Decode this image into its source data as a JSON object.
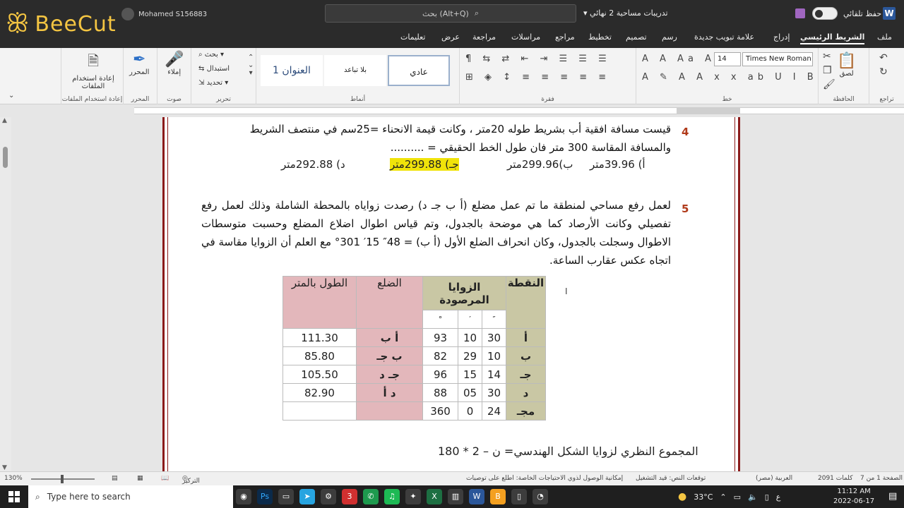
{
  "titlebar": {
    "brand": "BeeCut",
    "user": "Mohamed S156883",
    "search_placeholder": "بحث (Alt+Q)",
    "doc_title": "تدريبات مساحية 2 نهائي",
    "autosave": "حفظ تلقائي"
  },
  "tabs": [
    "ملف",
    "الشريط الرئيسي",
    "إدراج",
    "علامة تبويب جديدة",
    "رسم",
    "تصميم",
    "تخطيط",
    "مراجع",
    "مراسلات",
    "مراجعة",
    "عرض",
    "تعليمات"
  ],
  "ribbon": {
    "undo_label": "تراجع",
    "clipboard": {
      "paste": "لصق",
      "group": "الحافظة"
    },
    "font": {
      "name": "Times New Roman (",
      "size": "14",
      "group": "خط"
    },
    "paragraph": {
      "group": "فقرة"
    },
    "styles": {
      "items": [
        "عادي",
        "بلا تباعد",
        "العنوان 1"
      ],
      "group": "أنماط"
    },
    "editing": {
      "find": "بحث",
      "replace": "استبدال",
      "select": "تحديد",
      "group": "تحرير"
    },
    "voice": {
      "dictate": "إملاء",
      "group": "صوت"
    },
    "editor": {
      "label": "المحرر",
      "group": "المحرر"
    },
    "reuse": {
      "label": "إعادة استخدام الملفات",
      "group": "إعادة استخدام الملفات"
    }
  },
  "document": {
    "q4": {
      "num": "4",
      "text": "قيست مسافة افقية أب بشريط طوله 20متر ، وكانت قيمة الانحناء =25سم في منتصف الشريط والمسافة المقاسة 300 متر فان طول الخط الحقيقي = ..........",
      "options": [
        "أ) 39.96متر",
        "ب)299.96متر",
        "جـ) 299.88متر",
        "د) 292.88متر"
      ]
    },
    "q5": {
      "num": "5",
      "text": "لعمل رفع مساحي لمنطقة ما تم عمل مضلع (أ ب جـ د) رصدت زواياه بالمحطة الشاملة وذلك لعمل رفع تفصيلي وكانت الأرصاد كما هي موضحة بالجدول، وتم قياس اطوال اضلاع المضلع وحسبت متوسطات الاطوال وسجلت بالجدول، وكان انحراف الضلع الأول (أ ب) = 48″ 15′ 301° مع العلم أن الزوايا مقاسة في اتجاه عكس عقارب الساعة."
    },
    "table": {
      "headers": {
        "point": "النقطة",
        "angles": "الزوايا المرصودة",
        "side": "الضلع",
        "length": "الطول بالمتر"
      },
      "units": [
        "″",
        "′",
        "°"
      ],
      "rows": [
        {
          "point": "أ",
          "sec": "30",
          "min": "10",
          "deg": "93",
          "side": "أ ب",
          "length": "111.30"
        },
        {
          "point": "ب",
          "sec": "10",
          "min": "29",
          "deg": "82",
          "side": "ب جـ",
          "length": "85.80"
        },
        {
          "point": "جـ",
          "sec": "14",
          "min": "15",
          "deg": "96",
          "side": "جـ د",
          "length": "105.50"
        },
        {
          "point": "د",
          "sec": "30",
          "min": "05",
          "deg": "88",
          "side": "د أ",
          "length": "82.90"
        },
        {
          "point": "مجـ",
          "sec": "24",
          "min": "0",
          "deg": "360",
          "side": "",
          "length": ""
        }
      ]
    },
    "formula": "المجموع النظري لزوايا الشكل الهندسي= ن – 2 * 180"
  },
  "statusbar": {
    "page": "الصفحة 1 من 7",
    "words": "2091 كلمات",
    "lang": "العربية (مصر)",
    "predictions": "توقعات النص: قيد التشغيل",
    "accessibility": "إمكانية الوصول لذوي الاحتياجات الخاصة: اطلع على توصيات",
    "focus": "التركيز",
    "zoom": "130%"
  },
  "taskbar": {
    "search": "Type here to search",
    "temp": "33°C",
    "time": "11:12 AM",
    "date": "2022-06-17",
    "lang": "ع",
    "badge": "3"
  }
}
